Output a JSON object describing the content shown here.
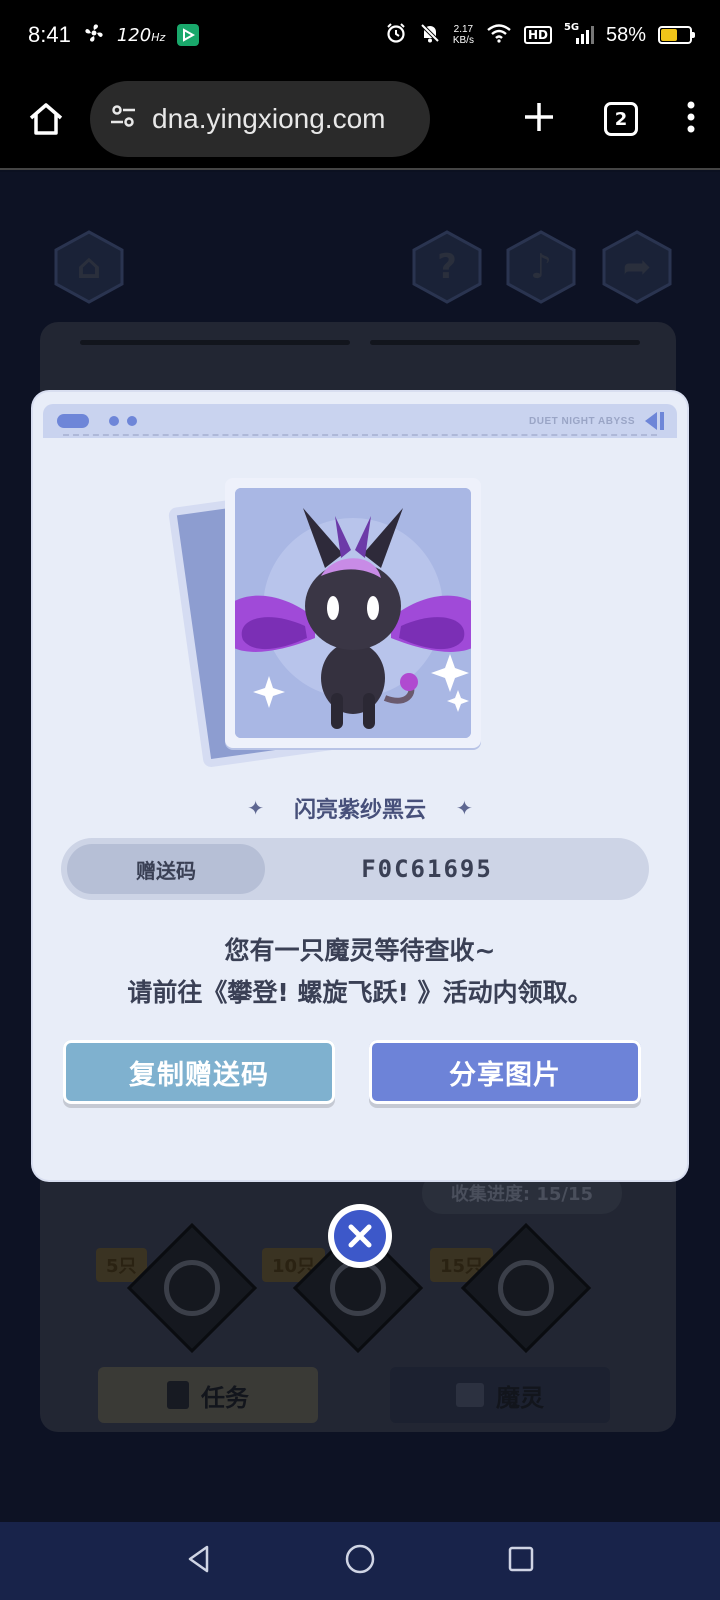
{
  "status_bar": {
    "time": "8:41",
    "refresh_rate": "120",
    "refresh_unit": "Hz",
    "net_speed_value": "2.17",
    "net_speed_unit": "KB/s",
    "hd_label": "HD",
    "signal_label": "5G",
    "battery_percent": "58%",
    "battery_level": 0.58,
    "icons": [
      "fan-icon",
      "play-store-icon",
      "alarm-icon",
      "mute-icon",
      "wifi-icon",
      "signal-icon",
      "battery-charging-icon"
    ]
  },
  "browser": {
    "url": "dna.yingxiong.com",
    "tab_count": "2",
    "icons": [
      "home-icon",
      "site-settings-icon",
      "new-tab-icon",
      "more-icon"
    ]
  },
  "game": {
    "top_icons": [
      "home-icon",
      "help-icon",
      "music-icon",
      "share-icon"
    ],
    "collection_progress": "收集进度: 15/15",
    "milestones": [
      "5只",
      "10只",
      "15只"
    ],
    "tabs": [
      {
        "label": "任务",
        "icon": "task-icon"
      },
      {
        "label": "魔灵",
        "icon": "pet-icon"
      }
    ]
  },
  "modal": {
    "brand": "DUET NIGHT ABYSS",
    "pet_name": "闪亮紫纱黑云",
    "code_label": "赠送码",
    "code_value": "F0C61695",
    "message_line1": "您有一只魔灵等待查收~",
    "message_line2": "请前往《攀登! 螺旋飞跃! 》活动内领取。",
    "copy_button": "复制赠送码",
    "share_button": "分享图片",
    "close_icon": "close-icon"
  },
  "colors": {
    "accent_blue": "#6d83d8",
    "copy_button": "#7fb1cf",
    "modal_bg": "#e8edf8",
    "close_button": "#3d58c9",
    "nav_bar": "#18234a"
  },
  "nav": {
    "icons": [
      "back-icon",
      "home-circle-icon",
      "recents-icon"
    ]
  }
}
